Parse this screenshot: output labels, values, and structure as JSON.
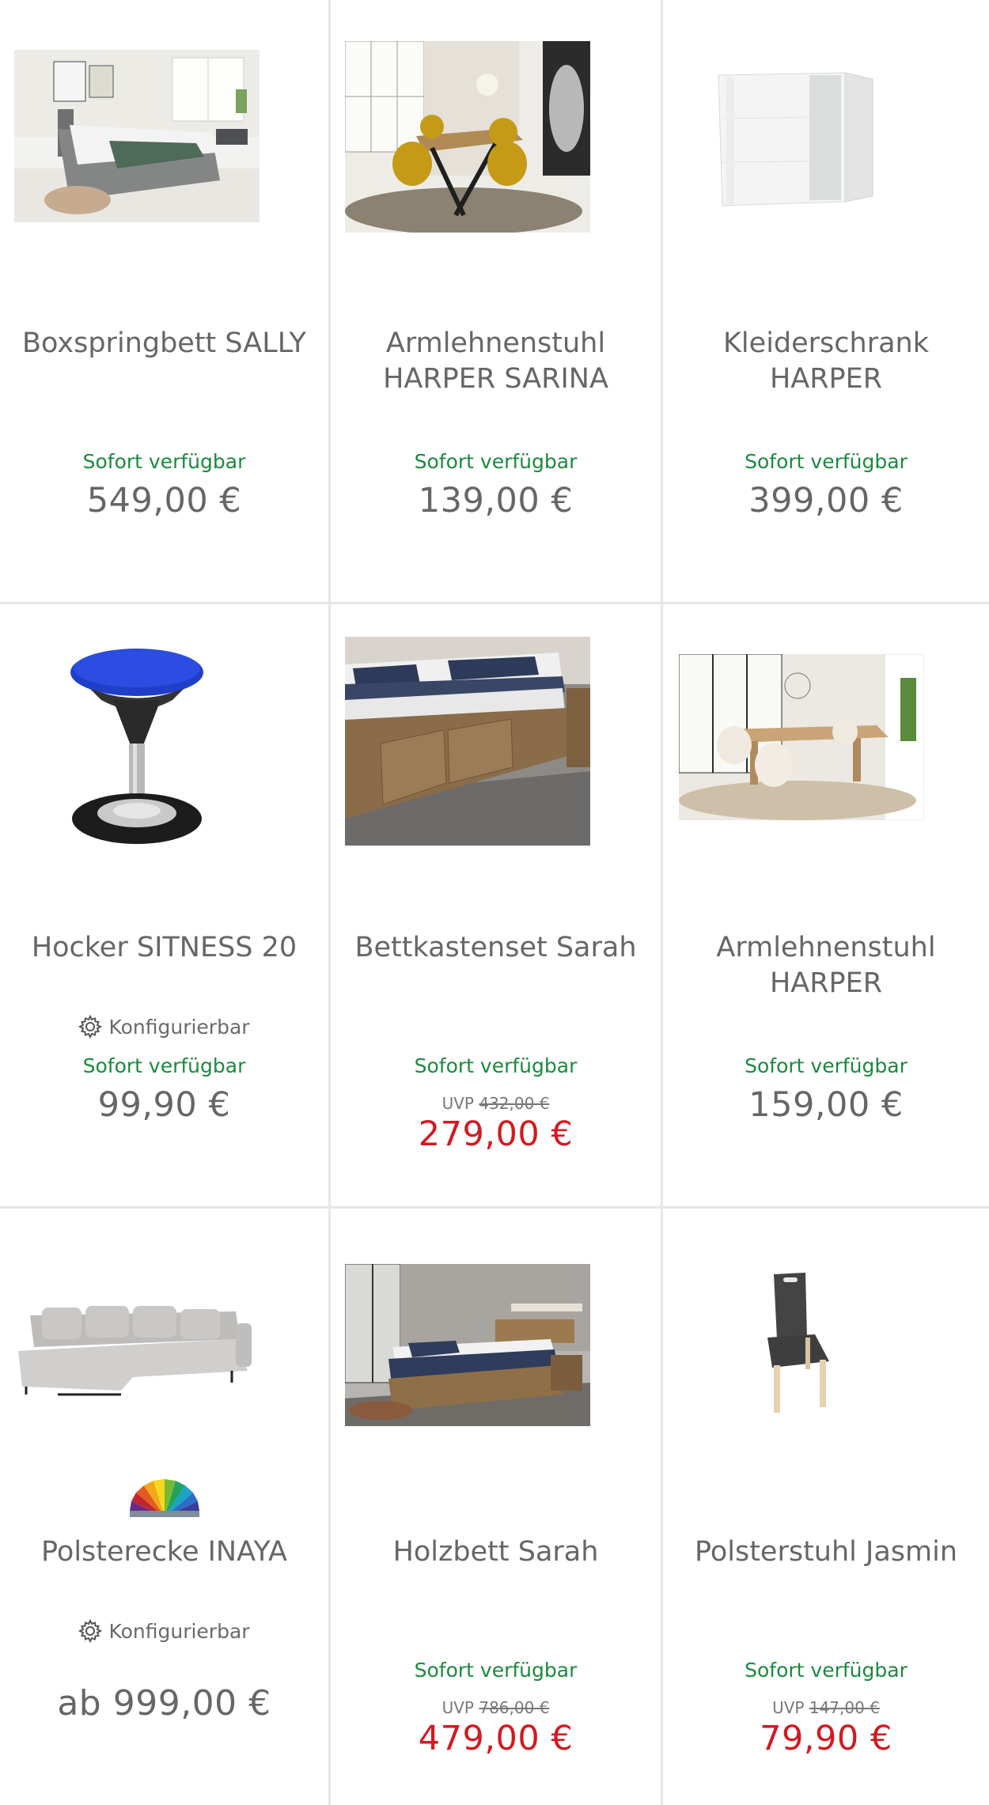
{
  "products": [
    {
      "image": "bed-photo",
      "title": "Boxspringbett SALLY",
      "availability": "Sofort verfügbar",
      "price": "549,00 €"
    },
    {
      "image": "dining-photo",
      "title": "Armlehnenstuhl HARPER SARINA",
      "availability": "Sofort verfügbar",
      "price": "139,00 €"
    },
    {
      "image": "wardrobe-photo",
      "title": "Kleiderschrank HARPER",
      "availability": "Sofort verfügbar",
      "price": "399,00 €"
    },
    {
      "image": "stool-photo",
      "title": "Hocker SITNESS 20",
      "configurable_label": "Konfigurierbar",
      "availability": "Sofort verfügbar",
      "price": "99,90 €"
    },
    {
      "image": "storage-bed-photo",
      "title": "Bettkastenset Sarah",
      "availability": "Sofort verfügbar",
      "uvp_label": "UVP",
      "uvp_price": "432,00 €",
      "price": "279,00 €"
    },
    {
      "image": "dining-room-photo",
      "title": "Armlehnenstuhl HARPER",
      "availability": "Sofort verfügbar",
      "price": "159,00 €"
    },
    {
      "image": "sofa-photo",
      "title": "Polsterecke INAYA",
      "configurable_label": "Konfigurierbar",
      "price": "ab 999,00 €"
    },
    {
      "image": "wood-bed-photo",
      "title": "Holzbett Sarah",
      "availability": "Sofort verfügbar",
      "uvp_label": "UVP",
      "uvp_price": "786,00 €",
      "price": "479,00 €"
    },
    {
      "image": "chair-photo",
      "title": "Polsterstuhl Jasmin",
      "availability": "Sofort verfügbar",
      "uvp_label": "UVP",
      "uvp_price": "147,00 €",
      "price": "79,90 €"
    }
  ],
  "colors": {
    "availability": "#1a8a3e",
    "sale_price": "#d41920",
    "regular_price": "#666666",
    "divider": "#e6e6e6"
  },
  "icons": {
    "configurable": "gear-icon",
    "color_options": "color-palette-icon"
  }
}
